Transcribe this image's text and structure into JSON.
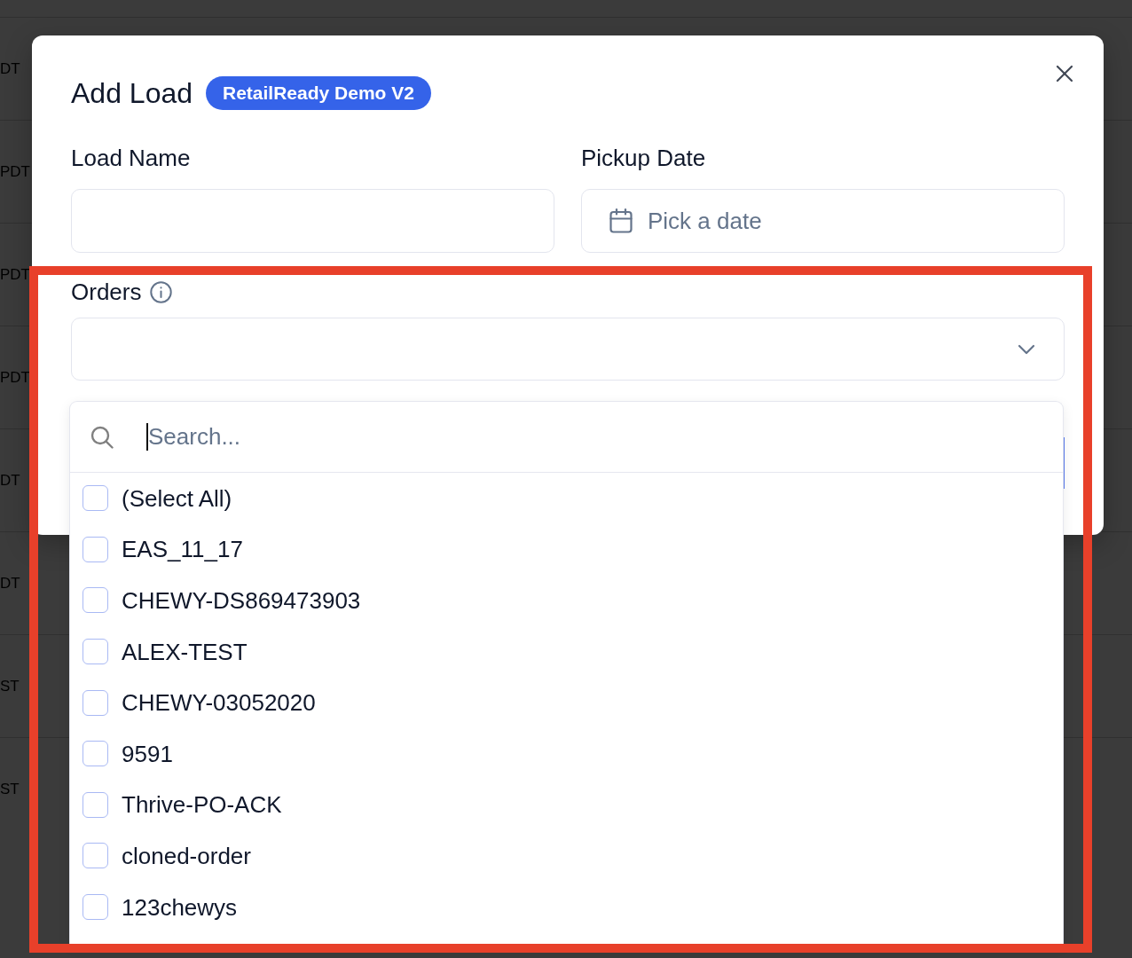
{
  "background_table": {
    "rows": [
      {
        "cell": "DT"
      },
      {
        "cell": "PDT"
      },
      {
        "cell": "PDT"
      },
      {
        "cell": "PDT"
      },
      {
        "cell": "DT"
      },
      {
        "cell": "DT"
      },
      {
        "cell": "ST"
      },
      {
        "cell": "ST"
      }
    ]
  },
  "dialog": {
    "title": "Add Load",
    "badge": "RetailReady Demo V2",
    "fields": [
      {
        "kind": "text",
        "label": "Load Name"
      },
      {
        "kind": "date",
        "label": "Pickup Date",
        "placeholder": "Pick a date"
      }
    ],
    "orders": {
      "label": "Orders",
      "expanded": true,
      "search": {
        "placeholder": "Search...",
        "focused": true
      },
      "options": [
        {
          "label": "(Select All)",
          "checked": false
        },
        {
          "label": "EAS_11_17",
          "checked": false
        },
        {
          "label": "CHEWY-DS869473903",
          "checked": false
        },
        {
          "label": "ALEX-TEST",
          "checked": false
        },
        {
          "label": "CHEWY-03052020",
          "checked": false
        },
        {
          "label": "9591",
          "checked": false
        },
        {
          "label": "Thrive-PO-ACK",
          "checked": false
        },
        {
          "label": "cloned-order",
          "checked": false
        },
        {
          "label": "123chewys",
          "checked": false
        }
      ]
    }
  },
  "annotation": {
    "kind": "outline"
  }
}
